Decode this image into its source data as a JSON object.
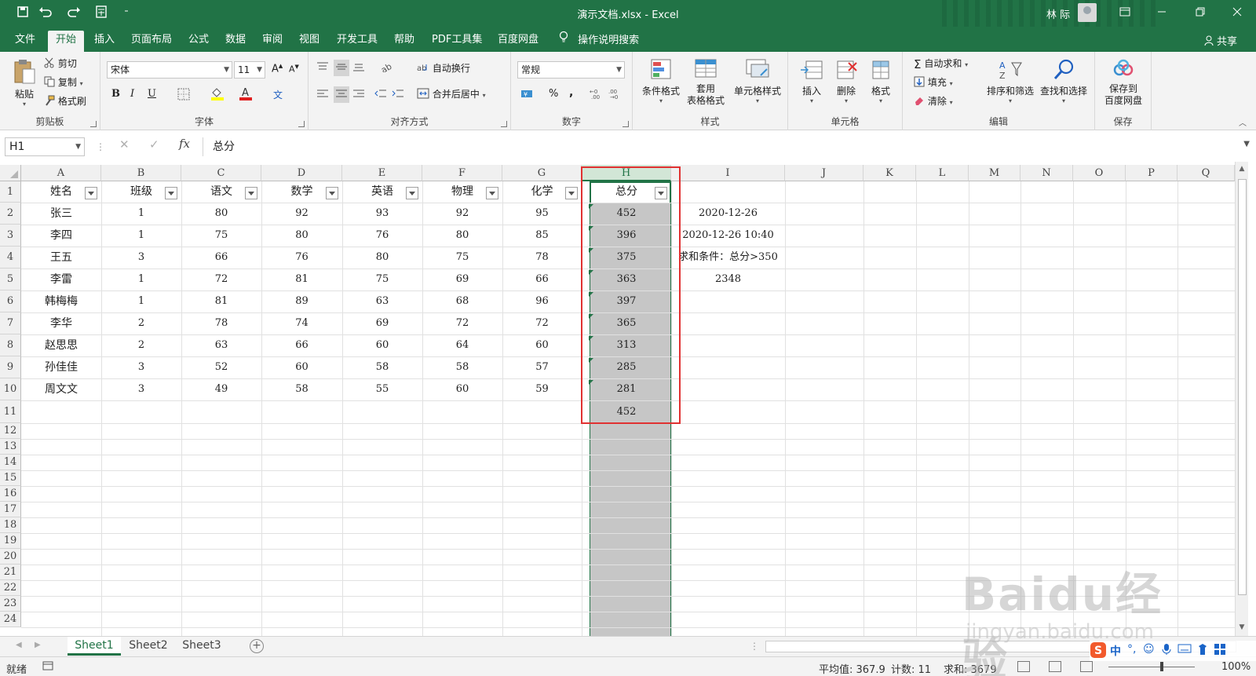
{
  "window": {
    "title": "演示文档.xlsx  -  Excel",
    "user": "林 际",
    "qa_more": "⁼"
  },
  "menu": {
    "tabs": [
      "文件",
      "开始",
      "插入",
      "页面布局",
      "公式",
      "数据",
      "审阅",
      "视图",
      "开发工具",
      "帮助",
      "PDF工具集",
      "百度网盘"
    ],
    "search": "操作说明搜索",
    "share": "共享"
  },
  "ribbon": {
    "clipboard": {
      "paste": "粘贴",
      "cut": "剪切",
      "copy": "复制",
      "format_painter": "格式刷",
      "label": "剪贴板"
    },
    "font": {
      "name": "宋体",
      "size": "11",
      "bold": "B",
      "italic": "I",
      "underline": "U",
      "label": "字体"
    },
    "alignment": {
      "wrap": "自动换行",
      "merge": "合并后居中",
      "label": "对齐方式"
    },
    "number": {
      "format": "常规",
      "percent": "%",
      "comma": ",",
      "label": "数字"
    },
    "styles": {
      "conditional": "条件格式",
      "table_line1": "套用",
      "table_line2": "表格格式",
      "cell_styles": "单元格样式",
      "label": "样式"
    },
    "cells": {
      "insert": "插入",
      "delete": "删除",
      "format": "格式",
      "label": "单元格"
    },
    "editing": {
      "autosum": "自动求和",
      "fill": "填充",
      "clear": "清除",
      "sort": "排序和筛选",
      "find": "查找和选择",
      "label": "编辑"
    },
    "save": {
      "line1": "保存到",
      "line2": "百度网盘",
      "label": "保存"
    }
  },
  "formula_bar": {
    "name_box": "H1",
    "formula": "总分",
    "fx": "fx"
  },
  "grid": {
    "columns": [
      "A",
      "B",
      "C",
      "D",
      "E",
      "F",
      "G",
      "H",
      "I",
      "J",
      "K",
      "L",
      "M",
      "N",
      "O",
      "P",
      "Q"
    ],
    "rows": [
      "1",
      "2",
      "3",
      "4",
      "5",
      "6",
      "7",
      "8",
      "9",
      "10",
      "11",
      "12",
      "13",
      "14",
      "15",
      "16",
      "17",
      "18",
      "19",
      "20",
      "21",
      "22",
      "23",
      "24"
    ],
    "headers": [
      "姓名",
      "班级",
      "语文",
      "数学",
      "英语",
      "物理",
      "化学",
      "总分"
    ],
    "data": [
      [
        "张三",
        "1",
        "80",
        "92",
        "93",
        "92",
        "95",
        "452"
      ],
      [
        "李四",
        "1",
        "75",
        "80",
        "76",
        "80",
        "85",
        "396"
      ],
      [
        "王五",
        "3",
        "66",
        "76",
        "80",
        "75",
        "78",
        "375"
      ],
      [
        "李雷",
        "1",
        "72",
        "81",
        "75",
        "69",
        "66",
        "363"
      ],
      [
        "韩梅梅",
        "1",
        "81",
        "89",
        "63",
        "68",
        "96",
        "397"
      ],
      [
        "李华",
        "2",
        "78",
        "74",
        "69",
        "72",
        "72",
        "365"
      ],
      [
        "赵思思",
        "2",
        "63",
        "66",
        "60",
        "64",
        "60",
        "313"
      ],
      [
        "孙佳佳",
        "3",
        "52",
        "60",
        "58",
        "58",
        "57",
        "285"
      ],
      [
        "周文文",
        "3",
        "49",
        "58",
        "55",
        "60",
        "59",
        "281"
      ]
    ],
    "h11": "452",
    "col_i": [
      "2020-12-26",
      "2020-12-26 10:40",
      "求和条件：总分>350",
      "2348"
    ]
  },
  "sheets": [
    "Sheet1",
    "Sheet2",
    "Sheet3"
  ],
  "status": {
    "ready": "就绪",
    "average": "平均值: 367.9",
    "count": "计数: 11",
    "sum": "求和: 3679",
    "zoom": "100%"
  },
  "watermark": {
    "line1": "Baidu经验",
    "line2": "jingyan.baidu.com"
  },
  "tray": {
    "ime": "中"
  },
  "colors": {
    "excel_green": "#217346",
    "highlight_red": "#e03131",
    "selection_gray": "#c6c6c6"
  }
}
